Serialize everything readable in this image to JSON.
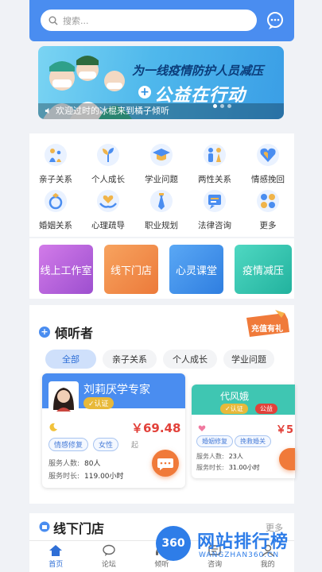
{
  "search": {
    "placeholder": "搜索..."
  },
  "banner": {
    "headline": "为一线疫情防护人员减压",
    "subline": "公益在行动",
    "ticker": "欢迎过时的冰棍来到橘子倾听"
  },
  "menu": [
    {
      "label": "亲子关系",
      "icon": "family-icon",
      "color": "#4a8df0"
    },
    {
      "label": "个人成长",
      "icon": "sprout-icon",
      "color": "#4a8df0"
    },
    {
      "label": "学业问题",
      "icon": "graduation-cap-icon",
      "color": "#4a8df0"
    },
    {
      "label": "两性关系",
      "icon": "couple-icon",
      "color": "#4a8df0"
    },
    {
      "label": "情感挽回",
      "icon": "heart-icon",
      "color": "#4a8df0"
    },
    {
      "label": "婚姻关系",
      "icon": "ring-icon",
      "color": "#4a8df0"
    },
    {
      "label": "心理疏导",
      "icon": "heart-hands-icon",
      "color": "#4a8df0"
    },
    {
      "label": "职业规划",
      "icon": "tie-icon",
      "color": "#4a8df0"
    },
    {
      "label": "法律咨询",
      "icon": "law-icon",
      "color": "#4a8df0"
    },
    {
      "label": "更多",
      "icon": "grid-more-icon",
      "color": "#4a8df0"
    }
  ],
  "categories": [
    {
      "label": "线上工作室",
      "color": "#b25fd6"
    },
    {
      "label": "线下门店",
      "color": "#f08a4a"
    },
    {
      "label": "心灵课堂",
      "color": "#3f8fe8"
    },
    {
      "label": "疫情减压",
      "color": "#2fc2b0"
    }
  ],
  "listeners": {
    "title": "倾听者",
    "promo": "充值有礼",
    "tabs": [
      "全部",
      "亲子关系",
      "个人成长",
      "学业问题"
    ],
    "cards": [
      {
        "name": "刘莉厌学专家",
        "badge": "认证",
        "price": "￥69.48",
        "price_unit": "起",
        "tags": [
          "情感修复",
          "女性"
        ],
        "stats": [
          {
            "label": "服务人数:",
            "value": "80人"
          },
          {
            "label": "服务时长:",
            "value": "119.00小时"
          }
        ]
      },
      {
        "name": "代风娥",
        "badge": "认证",
        "badge2": "公益",
        "price": "￥5",
        "tags": [
          "婚姻修复",
          "挽救婚关"
        ],
        "stats": [
          {
            "label": "服务人数:",
            "value": "23人"
          },
          {
            "label": "服务时长:",
            "value": "31.00小时"
          }
        ]
      }
    ]
  },
  "store": {
    "title": "线下门店",
    "more": "更多"
  },
  "tabbar": [
    {
      "label": "首页",
      "icon": "home-icon"
    },
    {
      "label": "论坛",
      "icon": "forum-icon"
    },
    {
      "label": "倾听",
      "icon": "listen-icon"
    },
    {
      "label": "咨询",
      "icon": "consult-icon"
    },
    {
      "label": "我的",
      "icon": "profile-icon"
    }
  ],
  "watermark": {
    "badge": "360",
    "text": "网站排行榜",
    "url": "WANGZHAN360.CN"
  }
}
